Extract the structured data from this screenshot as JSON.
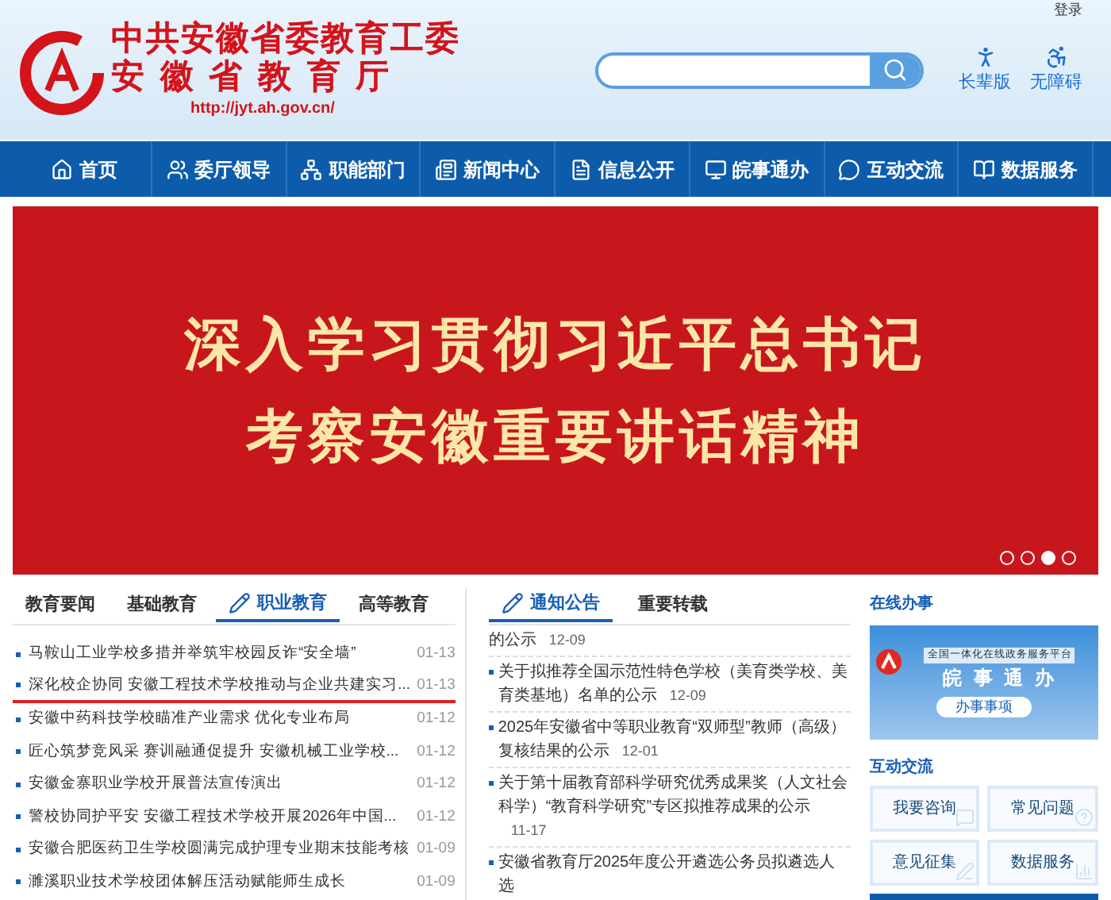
{
  "top_link": "登录",
  "logo": {
    "line1": "中共安徽省委教育工委",
    "line2": "安 徽 省 教 育 厅",
    "url": "http://jyt.ah.gov.cn/"
  },
  "tools": [
    {
      "kind": "elder",
      "label": "长辈版"
    },
    {
      "kind": "accessible",
      "label": "无障碍"
    }
  ],
  "nav": [
    {
      "kind": "home",
      "label": "首页"
    },
    {
      "kind": "people",
      "label": "委厅领导"
    },
    {
      "kind": "org",
      "label": "职能部门"
    },
    {
      "kind": "news",
      "label": "新闻中心"
    },
    {
      "kind": "doc",
      "label": "信息公开"
    },
    {
      "kind": "monitor",
      "label": "皖事通办"
    },
    {
      "kind": "chat",
      "label": "互动交流"
    },
    {
      "kind": "book",
      "label": "数据服务"
    }
  ],
  "banner": {
    "line1": "深入学习贯彻习近平总书记",
    "line2": "考察安徽重要讲话精神",
    "dots": [
      {
        "selected": false
      },
      {
        "selected": false
      },
      {
        "selected": true
      },
      {
        "selected": false
      }
    ]
  },
  "news": {
    "tabs": [
      {
        "label": "教育要闻",
        "selected": false
      },
      {
        "label": "基础教育",
        "selected": false
      },
      {
        "label": "职业教育",
        "selected": true
      },
      {
        "label": "高等教育",
        "selected": false
      }
    ],
    "rows": [
      {
        "title": "马鞍山工业学校多措并举筑牢校园反诈“安全墙”",
        "date": "01-13",
        "selected": false
      },
      {
        "title": "深化校企协同 安徽工程技术学校推动与企业共建实习...",
        "date": "01-13",
        "selected": true
      },
      {
        "title": "安徽中药科技学校瞄准产业需求 优化专业布局",
        "date": "01-12",
        "selected": false
      },
      {
        "title": "匠心筑梦竞风采 赛训融通促提升 安徽机械工业学校...",
        "date": "01-12",
        "selected": false
      },
      {
        "title": "安徽金寨职业学校开展普法宣传演出",
        "date": "01-12",
        "selected": false
      },
      {
        "title": "警校协同护平安 安徽工程技术学校开展2026年中国...",
        "date": "01-12",
        "selected": false
      },
      {
        "title": "安徽合肥医药卫生学校圆满完成护理专业期末技能考核",
        "date": "01-09",
        "selected": false
      },
      {
        "title": "濉溪职业技术学校团体解压活动赋能师生成长",
        "date": "01-09",
        "selected": false
      }
    ]
  },
  "notices": {
    "tabs": [
      {
        "label": "通知公告",
        "selected": true
      },
      {
        "label": "重要转载",
        "selected": false
      }
    ],
    "items": [
      {
        "title": "的公示",
        "date": "12-09",
        "bullet": false
      },
      {
        "title": "关于拟推荐全国示范性特色学校（美育类学校、美育类基地）名单的公示",
        "date": "12-09",
        "bullet": true
      },
      {
        "title": "2025年安徽省中等职业教育“双师型”教师（高级）复核结果的公示",
        "date": "12-01",
        "bullet": true
      },
      {
        "title": "关于第十届教育部科学研究优秀成果奖（人文社会科学）“教育科学研究”专区拟推荐成果的公示",
        "date": "11-17",
        "bullet": true
      },
      {
        "title": "安徽省教育厅2025年度公开遴选公务员拟遴选人选",
        "bullet": true
      }
    ]
  },
  "online": {
    "heading": "在线办事",
    "platform": "全国一体化在线政务服务平台",
    "name": "皖 事 通 办",
    "button": "办事事项"
  },
  "interact": {
    "heading": "互动交流",
    "tiles": [
      {
        "kind": "consult",
        "label": "我要咨询"
      },
      {
        "kind": "faq",
        "label": "常见问题"
      },
      {
        "kind": "feedback",
        "label": "意见征集"
      },
      {
        "kind": "data",
        "label": "数据服务"
      }
    ]
  }
}
